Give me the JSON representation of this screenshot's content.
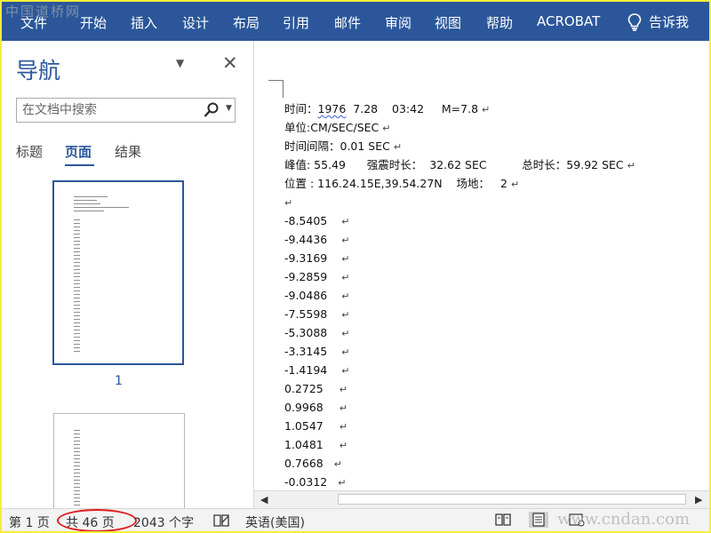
{
  "watermarks": {
    "top": "中国道桥网",
    "bottom": "www.cndan.com"
  },
  "ribbon": {
    "tabs": [
      "文件",
      "开始",
      "插入",
      "设计",
      "布局",
      "引用",
      "邮件",
      "审阅",
      "视图",
      "帮助",
      "ACROBAT"
    ],
    "tell_me": "告诉我",
    "tell_me_icon": "lightbulb-icon",
    "background": "#2b579a"
  },
  "nav": {
    "title": "导航",
    "search_placeholder": "在文档中搜索",
    "tabs": [
      "标题",
      "页面",
      "结果"
    ],
    "active_tab": "页面",
    "thumbnail_label": "1"
  },
  "document": {
    "lines": [
      [
        "时间：",
        "1976",
        "  7.28    03:42     M=7.8"
      ],
      [
        "单位:CM/SEC/SEC"
      ],
      [
        "时间间隔：0.01 SEC"
      ],
      [
        "峰值: 55.49      强震时长：  32.62 SEC          总时长：59.92 SEC"
      ],
      [
        "位置 : 116.24.15E,39.54.27N    场地：   2"
      ],
      [
        ""
      ],
      [
        "-8.5405"
      ],
      [
        "-9.4436"
      ],
      [
        "-9.3169"
      ],
      [
        "-9.2859"
      ],
      [
        "-9.0486"
      ],
      [
        "-7.5598"
      ],
      [
        "-5.3088"
      ],
      [
        "-3.3145"
      ],
      [
        "-1.4194"
      ],
      [
        "0.2725"
      ],
      [
        "0.9968"
      ],
      [
        "1.0547"
      ],
      [
        "1.0481"
      ],
      [
        "0.7668"
      ],
      [
        "-0.0312"
      ]
    ]
  },
  "status_bar": {
    "page": "第 1 页",
    "total_pages": "共 46 页",
    "word_count": "2043 个字",
    "language": "英语(美国)",
    "highlight_color": "#e01b1b"
  }
}
